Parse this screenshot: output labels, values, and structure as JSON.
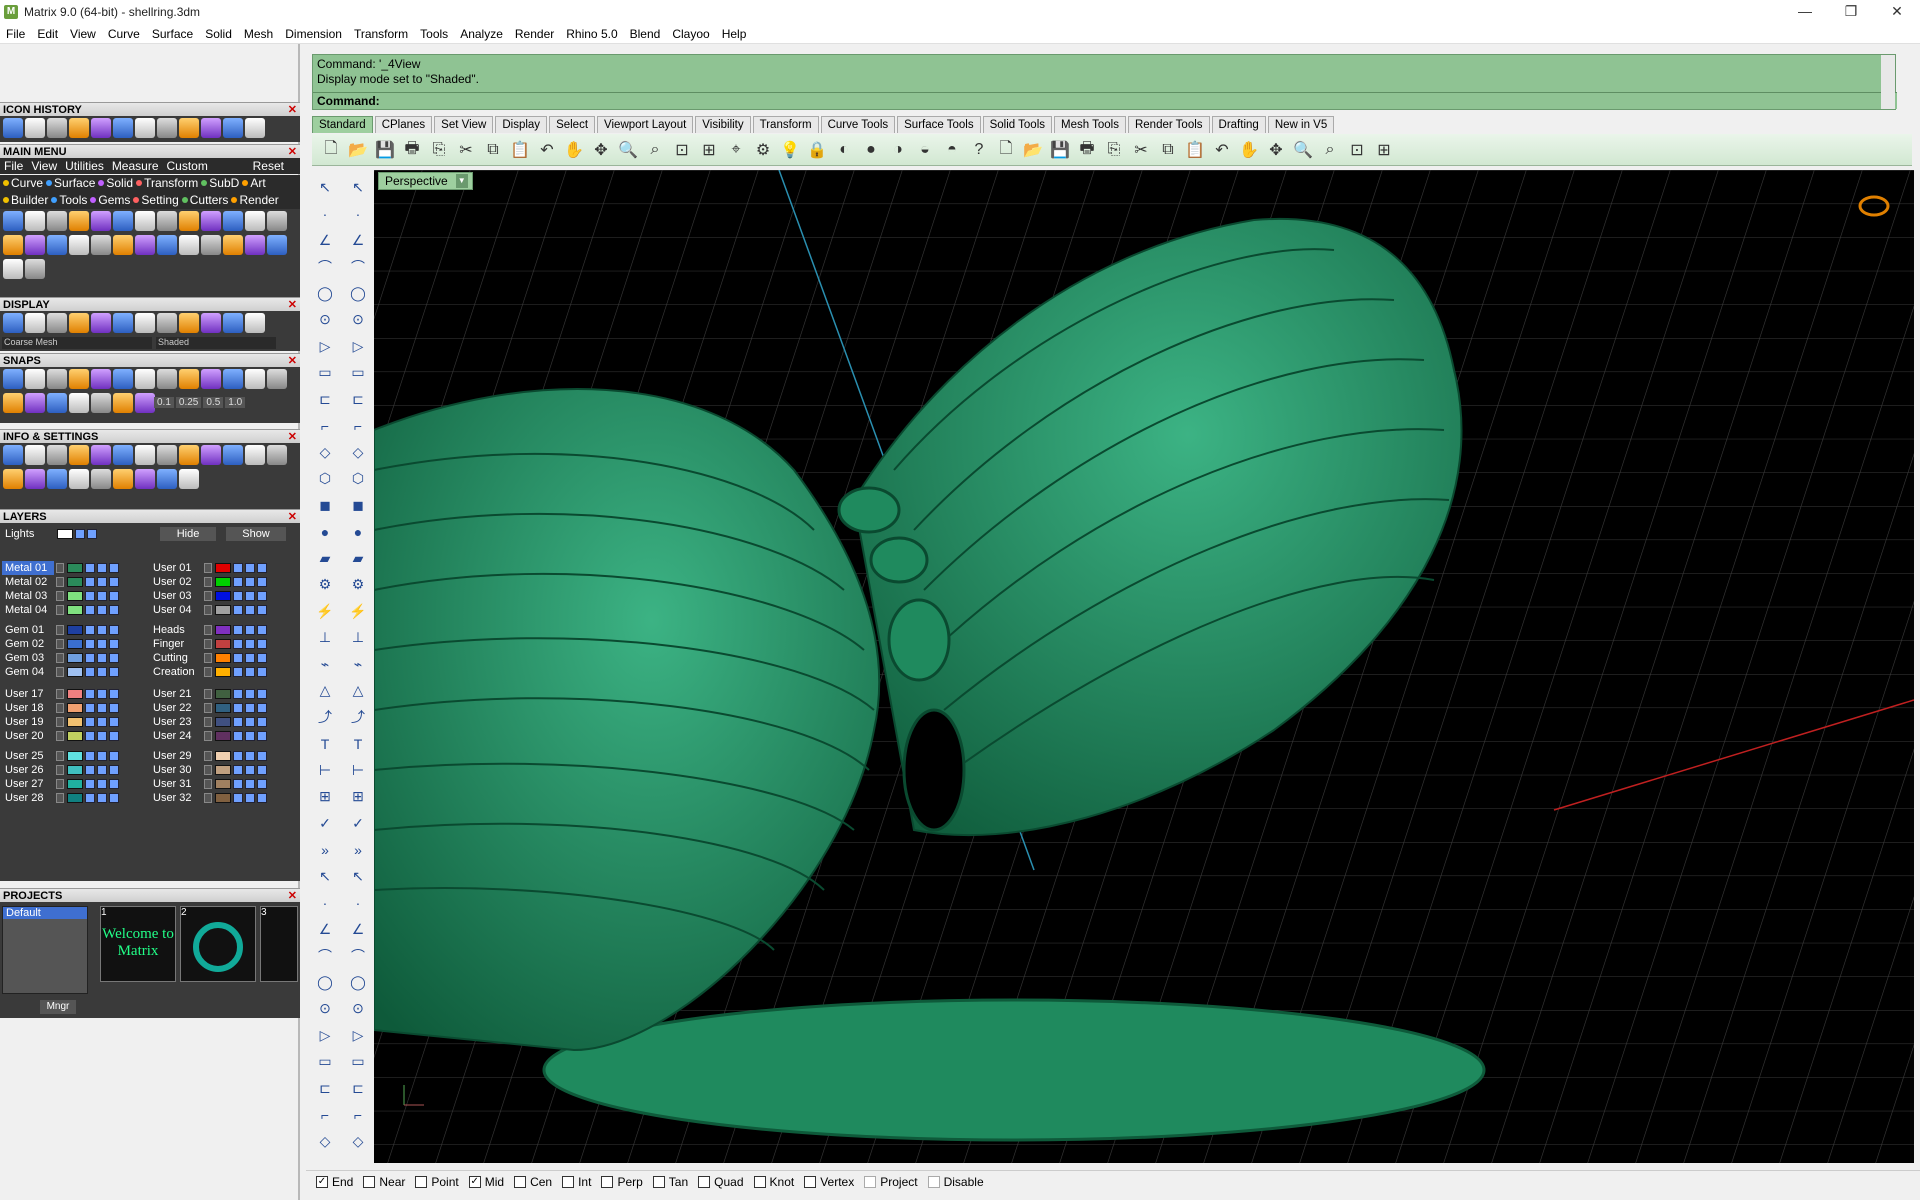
{
  "window": {
    "title": "Matrix 9.0 (64-bit) - shellring.3dm",
    "app_icon": "M",
    "minimize": "—",
    "restore": "❐",
    "close": "✕"
  },
  "menubar": [
    "File",
    "Edit",
    "View",
    "Curve",
    "Surface",
    "Solid",
    "Mesh",
    "Dimension",
    "Transform",
    "Tools",
    "Analyze",
    "Render",
    "Rhino 5.0",
    "Blend",
    "Clayoo",
    "Help"
  ],
  "left": {
    "icon_history": "ICON HISTORY",
    "main_menu": "MAIN MENU",
    "main_tabs": [
      "File",
      "View",
      "Utilities",
      "Measure",
      "Custom"
    ],
    "reset": "Reset",
    "cat_row1": [
      "Curve",
      "Surface",
      "Solid",
      "Transform",
      "SubD",
      "Art"
    ],
    "cat_row2": [
      "Builder",
      "Tools",
      "Gems",
      "Setting",
      "Cutters",
      "Render"
    ],
    "display": "DISPLAY",
    "mesh_select": "Coarse Mesh",
    "shade_select": "Shaded",
    "snaps": "SNAPS",
    "snap_values": [
      "0.1",
      "0.25",
      "0.5",
      "1.0"
    ],
    "info_settings": "INFO & SETTINGS",
    "layers_title": "LAYERS",
    "lights": "Lights",
    "hide": "Hide",
    "show": "Show",
    "layers_left": [
      "Metal 01",
      "Metal 02",
      "Metal 03",
      "Metal 04",
      "Gem 01",
      "Gem 02",
      "Gem 03",
      "Gem 04",
      "User 17",
      "User 18",
      "User 19",
      "User 20",
      "User 25",
      "User 26",
      "User 27",
      "User 28"
    ],
    "layers_right": [
      "User 01",
      "User 02",
      "User 03",
      "User 04",
      "Heads",
      "Finger",
      "Cutting",
      "Creation",
      "User 21",
      "User 22",
      "User 23",
      "User 24",
      "User 29",
      "User 30",
      "User 31",
      "User 32"
    ],
    "colors_left": [
      "#2a8a5a",
      "#2a8a5a",
      "#7fe07f",
      "#7fe07f",
      "#1e3fa0",
      "#3a6fd0",
      "#6f9fe0",
      "#9fc0f0",
      "#f08080",
      "#f0a070",
      "#f0c070",
      "#c0d060",
      "#60e0e0",
      "#40c0c0",
      "#20b0a0",
      "#108080"
    ],
    "colors_right": [
      "#e00000",
      "#00d000",
      "#0010e0",
      "#a0a0a0",
      "#8030c0",
      "#c04040",
      "#ff8000",
      "#ffb000",
      "#406040",
      "#306080",
      "#405080",
      "#603060",
      "#f0d0b0",
      "#c0a080",
      "#a08060",
      "#806040"
    ],
    "projects_title": "PROJECTS",
    "project_default": "Default",
    "thumb_nums": [
      "1",
      "2",
      "3"
    ],
    "thumb1_text": "Welcome to Matrix",
    "mngr": "Mngr"
  },
  "command": {
    "line1": "Command: '_4View",
    "line2": "Display mode set to \"Shaded\".",
    "prompt": "Command:"
  },
  "tabs": [
    "Standard",
    "CPlanes",
    "Set View",
    "Display",
    "Select",
    "Viewport Layout",
    "Visibility",
    "Transform",
    "Curve Tools",
    "Surface Tools",
    "Solid Tools",
    "Mesh Tools",
    "Render Tools",
    "Drafting",
    "New in V5"
  ],
  "viewport": {
    "label": "Perspective",
    "model_color": "#1f8a5e",
    "grid_color": "#3a3a3a"
  },
  "osnaps": [
    {
      "label": "End",
      "checked": true
    },
    {
      "label": "Near",
      "checked": false
    },
    {
      "label": "Point",
      "checked": false
    },
    {
      "label": "Mid",
      "checked": true
    },
    {
      "label": "Cen",
      "checked": false
    },
    {
      "label": "Int",
      "checked": false
    },
    {
      "label": "Perp",
      "checked": false
    },
    {
      "label": "Tan",
      "checked": false
    },
    {
      "label": "Quad",
      "checked": false
    },
    {
      "label": "Knot",
      "checked": false
    },
    {
      "label": "Vertex",
      "checked": false
    },
    {
      "label": "Project",
      "checked": false
    },
    {
      "label": "Disable",
      "checked": false
    }
  ]
}
